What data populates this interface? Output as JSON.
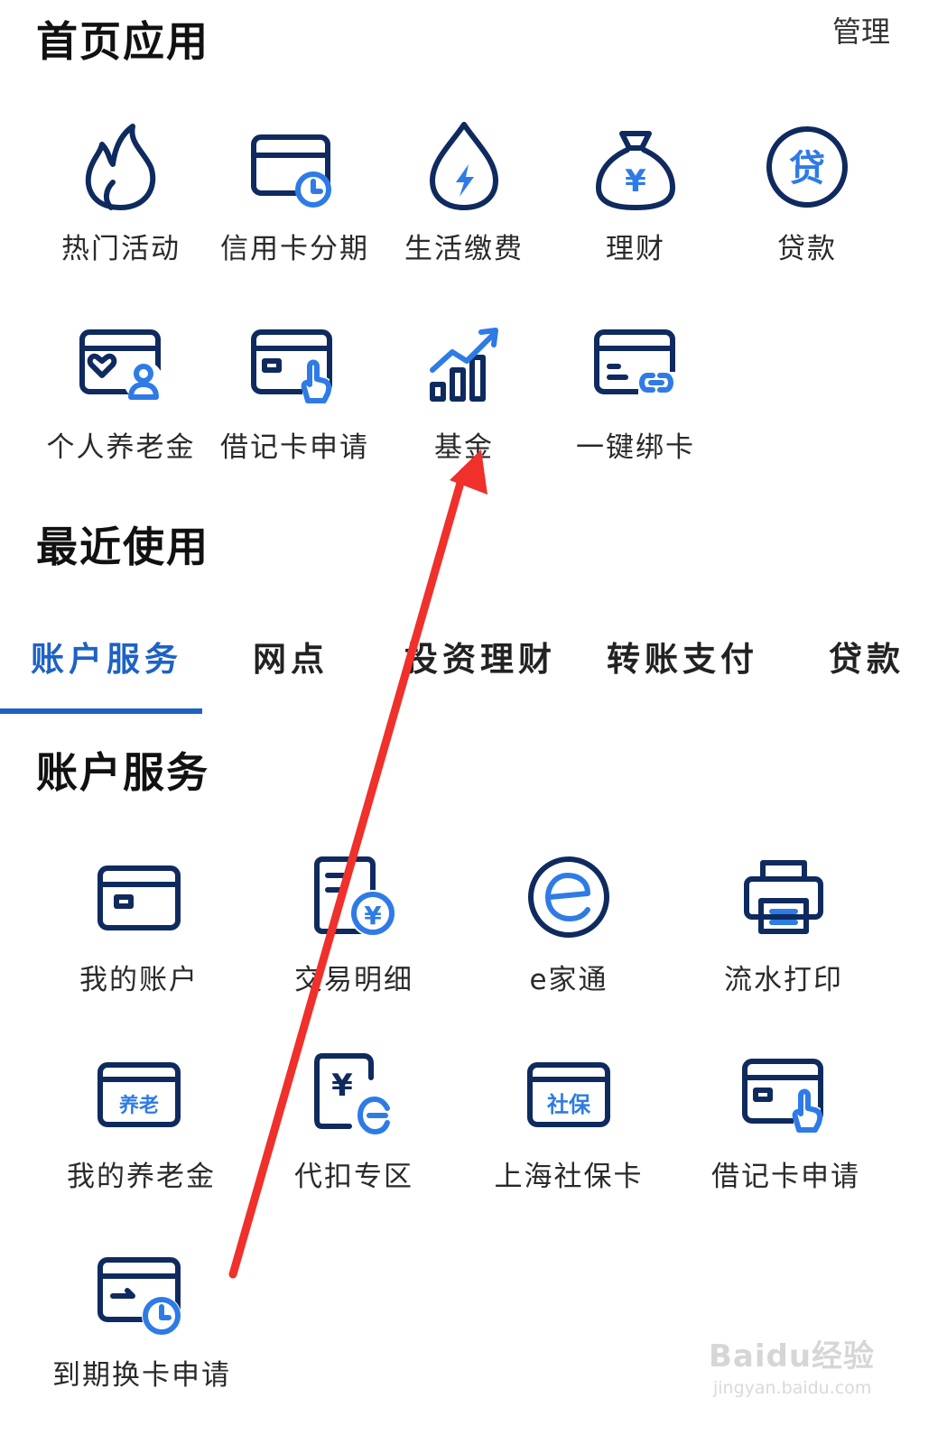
{
  "header": {
    "title": "首页应用",
    "manage_label": "管理"
  },
  "home_apps": [
    {
      "label": "热门活动",
      "icon": "flame-icon"
    },
    {
      "label": "信用卡分期",
      "icon": "card-clock-icon"
    },
    {
      "label": "生活缴费",
      "icon": "drop-bolt-icon"
    },
    {
      "label": "理财",
      "icon": "money-bag-icon"
    },
    {
      "label": "贷款",
      "icon": "loan-circle-icon"
    },
    {
      "label": "个人养老金",
      "icon": "card-person-icon"
    },
    {
      "label": "借记卡申请",
      "icon": "card-tap-icon"
    },
    {
      "label": "基金",
      "icon": "bar-chart-icon"
    },
    {
      "label": "一键绑卡",
      "icon": "card-link-icon"
    }
  ],
  "recent": {
    "title": "最近使用"
  },
  "tabs": [
    {
      "label": "账户服务",
      "active": true
    },
    {
      "label": "网点",
      "active": false
    },
    {
      "label": "投资理财",
      "active": false
    },
    {
      "label": "转账支付",
      "active": false
    },
    {
      "label": "贷款",
      "active": false
    }
  ],
  "account_section": {
    "title": "账户服务",
    "items": [
      {
        "label": "我的账户",
        "icon": "card-icon"
      },
      {
        "label": "交易明细",
        "icon": "receipt-yen-icon"
      },
      {
        "label": "e家通",
        "icon": "e-circle-icon"
      },
      {
        "label": "流水打印",
        "icon": "printer-icon"
      },
      {
        "label": "我的养老金",
        "icon": "pension-card-icon",
        "badge": "养老"
      },
      {
        "label": "代扣专区",
        "icon": "yen-refresh-icon",
        "badge": "¥"
      },
      {
        "label": "上海社保卡",
        "icon": "social-card-icon",
        "badge": "社保"
      },
      {
        "label": "借记卡申请",
        "icon": "card-tap-icon"
      },
      {
        "label": "到期换卡申请",
        "icon": "card-renew-icon"
      }
    ]
  },
  "icon_badges": {
    "loan": "贷",
    "money": "¥",
    "receipt": "¥"
  },
  "watermark": {
    "brand": "Baidu经验",
    "url": "jingyan.baidu.com"
  },
  "colors": {
    "accent": "#1e62c4",
    "icon_dark": "#0f2a5e",
    "icon_blue": "#2e7be6",
    "arrow": "#f0302b"
  }
}
